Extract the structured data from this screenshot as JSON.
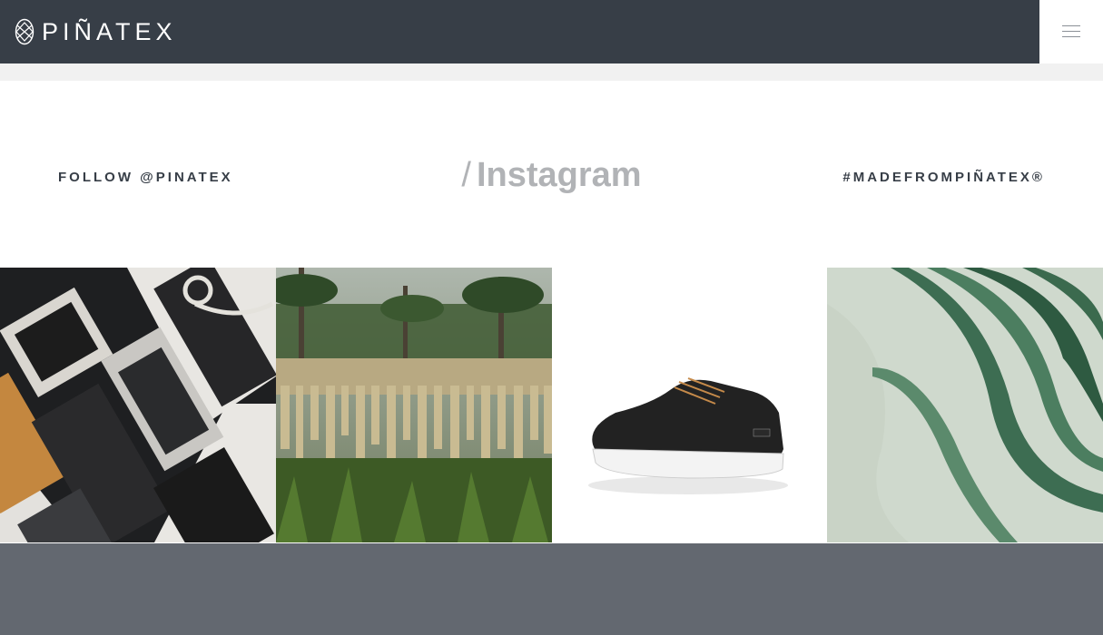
{
  "header": {
    "logo_text": "PIÑATEX",
    "menu_icon": "hamburger-icon"
  },
  "social": {
    "follow_label": "FOLLOW @PINATEX",
    "slash": "/",
    "title": "Instagram",
    "hashtag_label": "#MADEFROMPIÑATEX®"
  },
  "gallery": {
    "items": [
      {
        "subject": "flat-lay-wallets-and-phone-sleeves"
      },
      {
        "subject": "pineapple-fibres-drying-on-line"
      },
      {
        "subject": "black-sneaker"
      },
      {
        "subject": "pineapple-leaves"
      }
    ]
  },
  "colors": {
    "header_bg": "#373e47",
    "title_grey": "#b1b3b6",
    "footer_bg": "#636870"
  }
}
